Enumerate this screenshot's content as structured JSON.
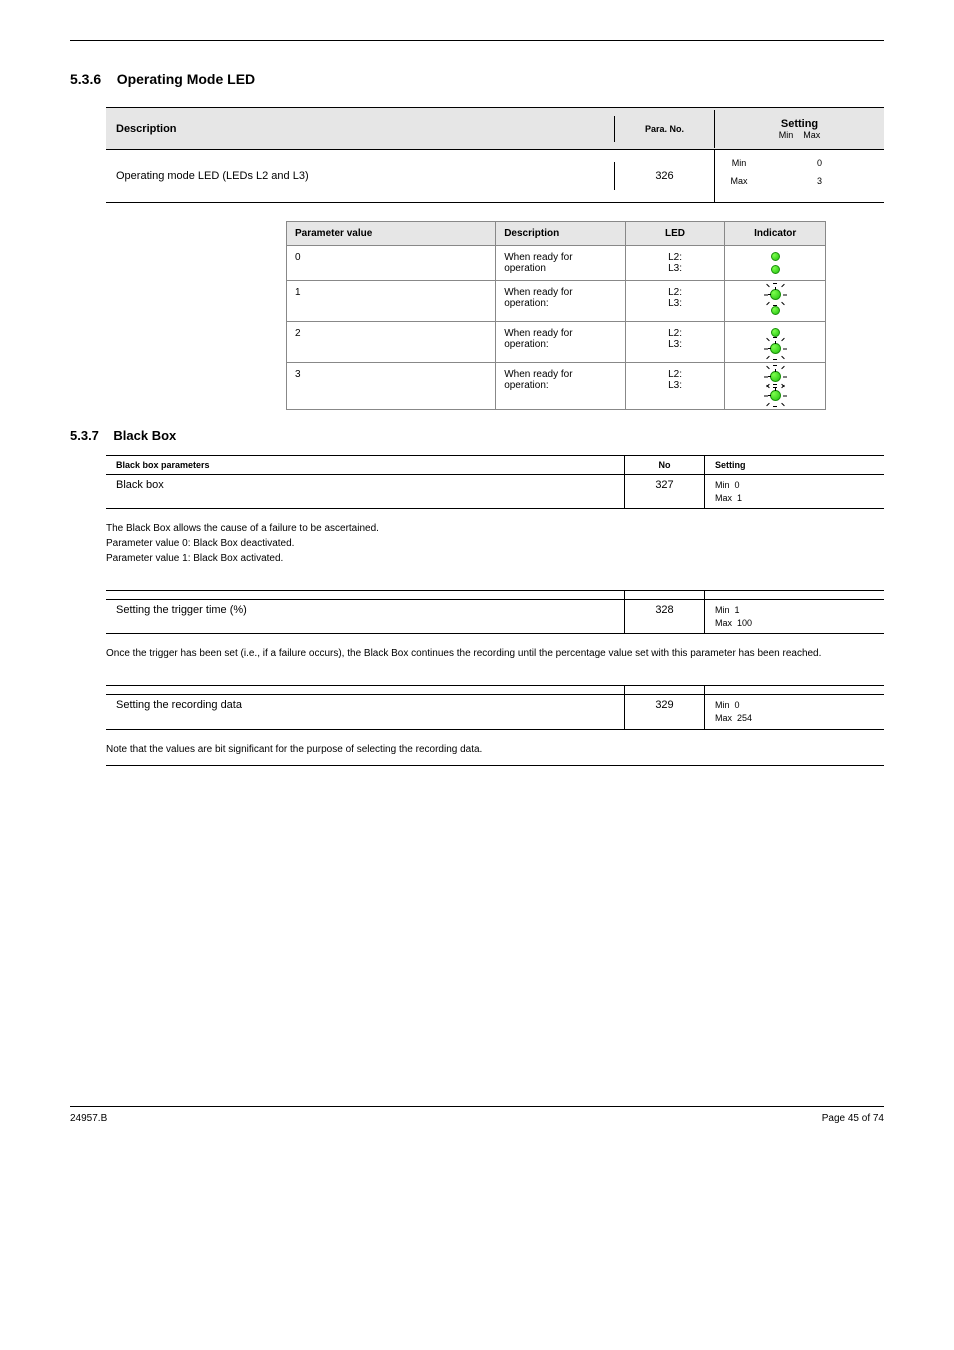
{
  "section": {
    "number": "5.3.6",
    "title": "Operating Mode LED"
  },
  "operating_mode": {
    "header": {
      "desc": "Description",
      "num_label": "Para. No.",
      "set_label": "Setting",
      "set_hint_label": "Min",
      "set_hint_value": "Max"
    },
    "row": {
      "desc": "Operating mode LED (LEDs L2 and L3)",
      "num": "326",
      "settings": [
        {
          "k": "Min",
          "v": "0"
        },
        {
          "k": "Max",
          "v": "3"
        }
      ]
    }
  },
  "indicator_table": {
    "headers": [
      "Parameter value",
      "Description",
      "LED",
      "Indicator"
    ],
    "rows": [
      {
        "value": "0",
        "desc": "When ready for operation",
        "led": [
          "L2:",
          "L3:"
        ],
        "mode": [
          "on",
          "on"
        ]
      },
      {
        "value": "1",
        "desc": "When ready for operation:",
        "led": [
          "L2:",
          "L3:"
        ],
        "mode": [
          "flash",
          "on"
        ]
      },
      {
        "value": "2",
        "desc": "When ready for operation:",
        "led": [
          "L2:",
          "L3:"
        ],
        "mode": [
          "on",
          "flash"
        ]
      },
      {
        "value": "3",
        "desc": "When ready for operation:",
        "led": [
          "L2:",
          "L3:"
        ],
        "mode": [
          "flash",
          "flash"
        ]
      }
    ]
  },
  "blackbox_section": {
    "number": "5.3.7",
    "title": "Black Box",
    "header": {
      "desc": "Black box parameters",
      "num": "No",
      "set": "Setting"
    },
    "blackbox_row": {
      "desc": "Black box",
      "num": "327",
      "settings": [
        {
          "k": "Min",
          "v": "0"
        },
        {
          "k": "Max",
          "v": "1"
        }
      ]
    },
    "blackbox_explain": "The Black Box allows the cause of a failure to be ascertained.\nParameter value 0: Black Box deactivated.\nParameter value 1: Black Box activated.",
    "trigger_row": {
      "desc": "Setting the trigger time (%)",
      "num": "328",
      "settings": [
        {
          "k": "Min",
          "v": "1"
        },
        {
          "k": "Max",
          "v": "100"
        }
      ]
    },
    "trigger_explain": "Once the trigger has been set (i.e., if a failure occurs), the Black Box continues the recording until the percentage value set with this parameter has been reached.",
    "data_row": {
      "desc": "Setting the recording data",
      "num": "329",
      "settings": [
        {
          "k": "Min",
          "v": "0"
        },
        {
          "k": "Max",
          "v": "254"
        }
      ]
    },
    "data_explain": "Note that the values are bit significant for the purpose of selecting the recording data."
  },
  "footer": {
    "left": "24957.B",
    "right": "Page 45 of 74"
  }
}
